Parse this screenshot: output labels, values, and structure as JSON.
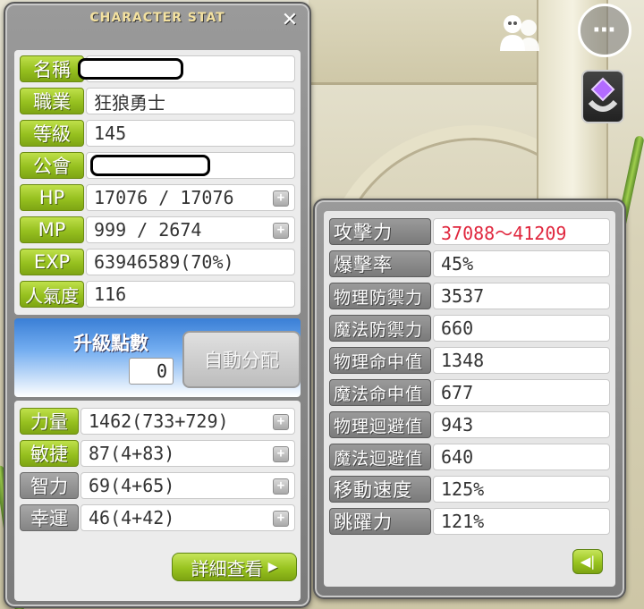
{
  "window": {
    "title": "CHARACTER STAT",
    "close": "✕"
  },
  "basic": [
    {
      "key": "name",
      "label": "名稱",
      "value": "",
      "redacted": true
    },
    {
      "key": "job",
      "label": "職業",
      "value": "狂狼勇士"
    },
    {
      "key": "level",
      "label": "等級",
      "value": "145"
    },
    {
      "key": "guild",
      "label": "公會",
      "value": "",
      "redacted": true
    },
    {
      "key": "hp",
      "label": "HP",
      "value": "17076 / 17076"
    },
    {
      "key": "mp",
      "label": "MP",
      "value": "999 / 2674"
    },
    {
      "key": "exp",
      "label": "EXP",
      "value": "63946589(70%)"
    },
    {
      "key": "fame",
      "label": "人氣度",
      "value": "116"
    }
  ],
  "ability": {
    "label": "升級點數",
    "points": "0",
    "auto_assign": "自動分配"
  },
  "stats": [
    {
      "key": "str",
      "label": "力量",
      "value": "1462(733+729)",
      "style": "green"
    },
    {
      "key": "dex",
      "label": "敏捷",
      "value": "87(4+83)",
      "style": "green"
    },
    {
      "key": "int",
      "label": "智力",
      "value": "69(4+65)",
      "style": "grey"
    },
    {
      "key": "luk",
      "label": "幸運",
      "value": "46(4+42)",
      "style": "grey"
    }
  ],
  "detail_button": "詳細查看",
  "detail_stats": [
    {
      "key": "attack",
      "label": "攻擊力",
      "value": "37088～41209",
      "highlight": true
    },
    {
      "key": "crit",
      "label": "爆擊率",
      "value": "45%"
    },
    {
      "key": "pdef",
      "label": "物理防禦力",
      "value": "3537"
    },
    {
      "key": "mdef",
      "label": "魔法防禦力",
      "value": "660"
    },
    {
      "key": "pacc",
      "label": "物理命中值",
      "value": "1348"
    },
    {
      "key": "macc",
      "label": "魔法命中值",
      "value": "677"
    },
    {
      "key": "peva",
      "label": "物理迴避值",
      "value": "943"
    },
    {
      "key": "meva",
      "label": "魔法迴避值",
      "value": "640"
    },
    {
      "key": "speed",
      "label": "移動速度",
      "value": "125%"
    },
    {
      "key": "jump",
      "label": "跳躍力",
      "value": "121%"
    }
  ],
  "colors": {
    "label_green": "#96c01f",
    "label_grey": "#848484",
    "attack_red": "#e0263d",
    "title_gold": "#f3e1a0"
  },
  "hud": {
    "friends_icon": "friends-icon",
    "more_icon": "⋯",
    "skill_icon": "skill-ring-icon"
  }
}
